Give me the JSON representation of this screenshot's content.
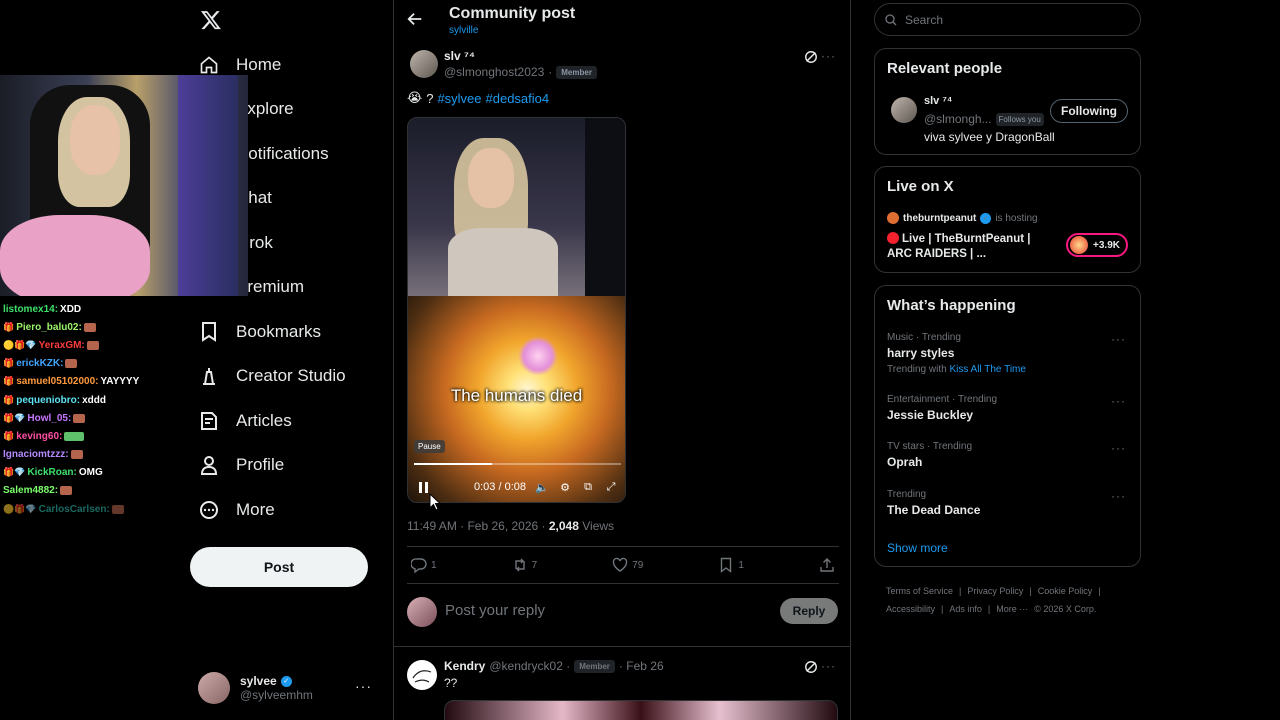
{
  "nav": {
    "items": [
      {
        "label": "Home",
        "icon": "home-icon"
      },
      {
        "label": "Explore",
        "icon": "search-icon"
      },
      {
        "label": "Notifications",
        "icon": "bell-icon"
      },
      {
        "label": "Chat",
        "icon": "mail-icon"
      },
      {
        "label": "Grok",
        "icon": "grok-icon"
      },
      {
        "label": "Premium",
        "icon": "x-icon"
      },
      {
        "label": "Bookmarks",
        "icon": "bookmark-icon"
      },
      {
        "label": "Creator Studio",
        "icon": "creator-icon"
      },
      {
        "label": "Articles",
        "icon": "articles-icon"
      },
      {
        "label": "Profile",
        "icon": "person-icon"
      },
      {
        "label": "More",
        "icon": "more-circle-icon"
      }
    ],
    "post_button": "Post",
    "account": {
      "name": "sylvee",
      "handle": "@sylveemhm"
    }
  },
  "chat": [
    {
      "user": "listomex14:",
      "text": "XDD",
      "color": "#3ce06a"
    },
    {
      "user": "Piero_balu02:",
      "text": "",
      "color": "#9cf56b"
    },
    {
      "user": "YeraxGM:",
      "text": "",
      "color": "#ff3c3c"
    },
    {
      "user": "erickKZK:",
      "text": "",
      "color": "#3fa6ff"
    },
    {
      "user": "samuel05102000:",
      "text": "YAYYYY",
      "color": "#ff9a3c"
    },
    {
      "user": "pequeniobro:",
      "text": "xddd",
      "color": "#5ee3f3"
    },
    {
      "user": "Howl_05:",
      "text": "",
      "color": "#c776ff"
    },
    {
      "user": "keving60:",
      "text": "",
      "color": "#ff4fa3"
    },
    {
      "user": "Ignaciomtzzz:",
      "text": "",
      "color": "#b48bff"
    },
    {
      "user": "KickRoan:",
      "text": "OMG",
      "color": "#3ce06a"
    },
    {
      "user": "Salem4882:",
      "text": "",
      "color": "#7cff6b"
    },
    {
      "user": "CarlosCarlsen:",
      "text": "",
      "color": "#2fbfb2"
    }
  ],
  "header": {
    "title": "Community post",
    "subtitle": "sylville"
  },
  "post": {
    "name": "slv ⁷⁴",
    "handle": "@slmonghost2023",
    "badge": "Member",
    "emoji": "😭",
    "question": "?",
    "hashtags": [
      "#sylvee",
      "#dedsafio4"
    ],
    "video": {
      "caption": "The humans died",
      "tooltip": "Pause",
      "time": "0:03 / 0:08",
      "progress": 0.375
    },
    "time": "11:49 AM · Feb 26, 2026 · ",
    "views_count": "2,048",
    "views_label": " Views",
    "replies": "1",
    "reposts": "7",
    "likes": "79",
    "bookmarks": "1"
  },
  "reply": {
    "placeholder": "Post your reply",
    "button": "Reply"
  },
  "next_post": {
    "name": "Kendry",
    "handle": "@kendryck02 ·",
    "badge": "Member",
    "date": "· Feb 26",
    "text": "??"
  },
  "search": {
    "placeholder": "Search"
  },
  "relevant": {
    "title": "Relevant people",
    "name": "slv ⁷⁴",
    "handle": "@slmongh...",
    "follows_you": "Follows you",
    "bio": "viva sylvee y DragonBall",
    "button": "Following"
  },
  "live": {
    "title": "Live on X",
    "host": "theburntpeanut",
    "hosting": "is hosting",
    "stream_title": "Live | TheBurntPeanut | ARC RAIDERS | ...",
    "count": "+3.9K"
  },
  "trending": {
    "title": "What’s happening",
    "items": [
      {
        "category": "Music · Trending",
        "topic": "harry styles",
        "with_label": "Trending with ",
        "with": "Kiss All The Time"
      },
      {
        "category": "Entertainment · Trending",
        "topic": "Jessie Buckley"
      },
      {
        "category": "TV stars · Trending",
        "topic": "Oprah"
      },
      {
        "category": "Trending",
        "topic": "The Dead Dance"
      }
    ],
    "show_more": "Show more"
  },
  "footer": [
    "Terms of Service",
    "|",
    "Privacy Policy",
    "|",
    "Cookie Policy",
    "|",
    "Accessibility",
    "|",
    "Ads info",
    "|",
    "More ···",
    "© 2026 X Corp."
  ],
  "colors": {
    "accent": "#1d9bf0",
    "bg": "#000000",
    "border": "#2f3336",
    "muted": "#71767b",
    "live": "#f91880"
  }
}
